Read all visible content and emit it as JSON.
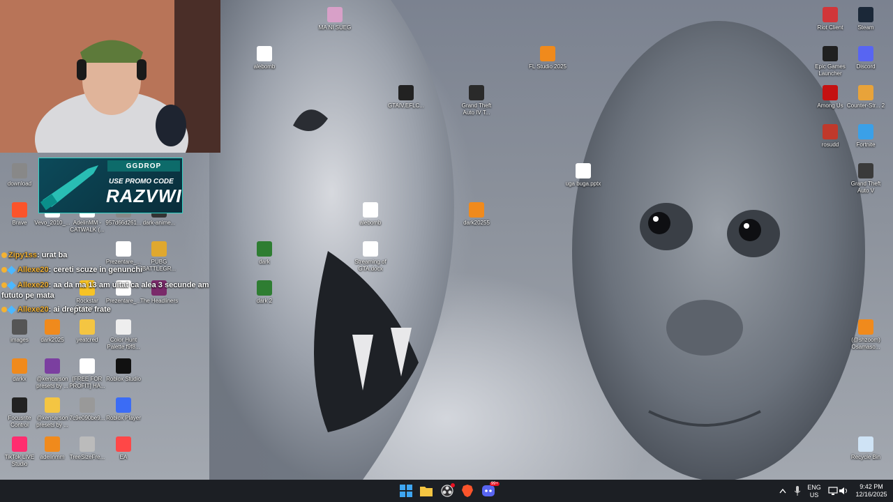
{
  "desktop_icons": [
    {
      "label": "MA NI SUEG",
      "icon": "image-icon",
      "color": "#d8a0c8"
    },
    {
      "label": "alebomb",
      "icon": "video-file-icon",
      "color": "#ffffff"
    },
    {
      "label": "FL Studio 2025",
      "icon": "fl-studio-icon",
      "color": "#f08a1c"
    },
    {
      "label": "GTAIV.EFLC...",
      "icon": "fusion-fix-icon",
      "color": "#222222"
    },
    {
      "label": "Grand Theft Auto IV T...",
      "icon": "gta4-icon",
      "color": "#2a2a2a"
    },
    {
      "label": "Riot Client",
      "icon": "riot-client-icon",
      "color": "#d13639"
    },
    {
      "label": "Steam",
      "icon": "steam-icon",
      "color": "#1b2838"
    },
    {
      "label": "Epic Games Launcher",
      "icon": "epic-games-icon",
      "color": "#202020"
    },
    {
      "label": "Discord",
      "icon": "discord-icon",
      "color": "#5865f2"
    },
    {
      "label": "Among Us",
      "icon": "among-us-icon",
      "color": "#c51111"
    },
    {
      "label": "Counter-Str... 2",
      "icon": "cs2-icon",
      "color": "#e8a33a"
    },
    {
      "label": "rosudd",
      "icon": "rosudd-icon",
      "color": "#c0392b"
    },
    {
      "label": "Fortnite",
      "icon": "fortnite-icon",
      "color": "#3aa0e8"
    },
    {
      "label": "Grand Theft Auto V",
      "icon": "gta5-icon",
      "color": "#3a3a3a"
    },
    {
      "label": "uga buga.pptx",
      "icon": "document-icon",
      "color": "#ffffff"
    },
    {
      "label": "alebomb",
      "icon": "video-file-icon",
      "color": "#ffffff"
    },
    {
      "label": "dark20255",
      "icon": "fl-studio-icon",
      "color": "#f08a1c"
    },
    {
      "label": "dark",
      "icon": "image-icon",
      "color": "#2e7d32"
    },
    {
      "label": "Streaming of GTA.docx",
      "icon": "document-icon",
      "color": "#ffffff"
    },
    {
      "label": "dark 2",
      "icon": "image-icon",
      "color": "#2e7d32"
    },
    {
      "label": "(@shzoom) Osamaso...",
      "icon": "fl-studio-icon",
      "color": "#f08a1c"
    },
    {
      "label": "Recycle Bin",
      "icon": "recycle-bin-icon",
      "color": "#cfe3f5"
    },
    {
      "label": "download",
      "icon": "image-icon",
      "color": "#888888"
    },
    {
      "label": "Brave",
      "icon": "brave-icon",
      "color": "#fb542b"
    },
    {
      "label": "Vevo_2010_...",
      "icon": "video-file-icon",
      "color": "#ffffff"
    },
    {
      "label": "AdelinMM - CATWALK (...",
      "icon": "video-file-icon",
      "color": "#ffffff"
    },
    {
      "label": "957d66d261...",
      "icon": "image-icon",
      "color": "#888888"
    },
    {
      "label": "dark-anime...",
      "icon": "image-icon",
      "color": "#333333"
    },
    {
      "label": "Prezentare_...",
      "icon": "document-icon",
      "color": "#ffffff"
    },
    {
      "label": "PUBG BATTLEGR...",
      "icon": "pubg-icon",
      "color": "#e0a82e"
    },
    {
      "label": "Rockstar Games ...",
      "icon": "rockstar-icon",
      "color": "#f7c325"
    },
    {
      "label": "Prezentare_...",
      "icon": "document-icon",
      "color": "#ffffff"
    },
    {
      "label": "The Headliners",
      "icon": "headliners-icon",
      "color": "#7a2a6a"
    },
    {
      "label": "images",
      "icon": "image-icon",
      "color": "#555555"
    },
    {
      "label": "dark2025",
      "icon": "fl-studio-icon",
      "color": "#f08a1c"
    },
    {
      "label": "yeatcred",
      "icon": "folder-icon",
      "color": "#f4c542"
    },
    {
      "label": "Color Hunt Palette f9f8...",
      "icon": "image-icon",
      "color": "#eeeeee"
    },
    {
      "label": "darkx",
      "icon": "fl-studio-icon",
      "color": "#f08a1c"
    },
    {
      "label": "@kencarson presets by ...",
      "icon": "winrar-icon",
      "color": "#7b3fa0"
    },
    {
      "label": "[FREE FOR PROFIT] HA...",
      "icon": "video-file-icon",
      "color": "#ffffff"
    },
    {
      "label": "Roblox Studio",
      "icon": "roblox-studio-icon",
      "color": "#111111"
    },
    {
      "label": "Focusrite Control",
      "icon": "focusrite-icon",
      "color": "#222222"
    },
    {
      "label": "@kencarson presets by ...",
      "icon": "folder-icon",
      "color": "#f4c542"
    },
    {
      "label": "7c9e090be9...",
      "icon": "image-icon",
      "color": "#999999"
    },
    {
      "label": "Roblox Player",
      "icon": "roblox-icon",
      "color": "#3b6cf5"
    },
    {
      "label": "TikTok LIVE Studio",
      "icon": "tiktok-icon",
      "color": "#ff2d6f"
    },
    {
      "label": "adelinmm",
      "icon": "fl-studio-icon",
      "color": "#f08a1c"
    },
    {
      "label": "TreeSizeFre...",
      "icon": "treesize-icon",
      "color": "#bbbbbb"
    },
    {
      "label": "EA",
      "icon": "ea-icon",
      "color": "#ff4747"
    }
  ],
  "overlay": {
    "promo": {
      "brand": "GGDROP",
      "tagline": "USE PROMO CODE",
      "code": "RAZVWI"
    },
    "chat": [
      {
        "user": "Zipy1ss",
        "message": "urat ba"
      },
      {
        "user": "Allexe20",
        "message": "cereti scuze in genunchi"
      },
      {
        "user": "Allexe20",
        "message": "aa da ma 13 am uitat ca alea 3 secunde am fututo pe mata"
      },
      {
        "user": "Allexe20",
        "message": "ai dreptate frate"
      }
    ]
  },
  "taskbar": {
    "pinned": [
      {
        "name": "start-button",
        "icon": "windows-icon"
      },
      {
        "name": "file-explorer-button",
        "icon": "folder-icon"
      },
      {
        "name": "obs-button",
        "icon": "obs-icon"
      },
      {
        "name": "brave-button",
        "icon": "brave-icon"
      },
      {
        "name": "discord-button",
        "icon": "discord-icon",
        "badge": "99+"
      }
    ],
    "tray": {
      "language_line1": "ENG",
      "language_line2": "US",
      "time": "9:42 PM",
      "date": "12/16/2025"
    }
  },
  "colors": {
    "taskbar_bg": "#1c1f24",
    "accent": "#0078d4",
    "chat_user": "#f3b233"
  }
}
